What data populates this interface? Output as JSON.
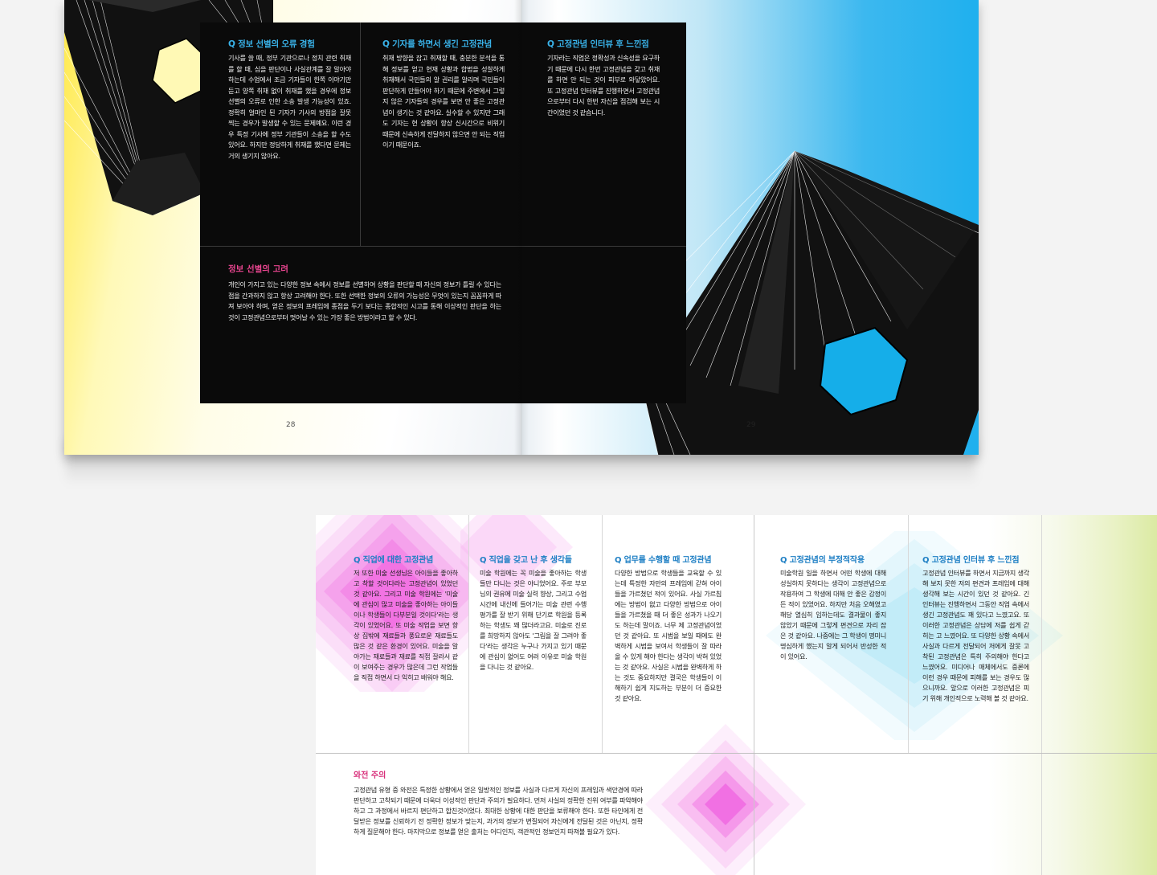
{
  "top_spread": {
    "left_page": {
      "columns": [
        {
          "heading": "Q 정보 선별의 오류 경험",
          "body": "기사를 쓸 때, 정부 기관으로나 정치 관련 취재를 할 때, 심을 판단이나 사실관계를 잘 알아야 하는데 수업에서 조금 기자들이 한쪽 이야기만 듣고 양쪽 취재 없이 취재를 했을 경우에 정보 선별의 오류로 인한 소송 발생 가능성이 있죠. 정확히 얼마인 된 기자가 기사의 방점을 잘못 찍는 경우가 발생할 수 있는 문제예요. 이런 경우 특정 기사에 정부 기관들이 소송을 할 수도 있어요. 하지만 정당하게 취재를 했다면 문제는 거의 생기지 않아요."
        },
        {
          "heading": "Q 기자를 하면서 생긴 고정관념",
          "body": "취재 방향을 잡고 취재할 때, 충분한 분석을 통해 정보를 얻고 현재 상황과 합법을 성찰하게 취재해서 국민들의 알 권리를 알리며 국민들이 판단하게 만들어야 하기 때문에 주변에서 그렇지 않은 기자들의 경우를 보면 안 좋은 고정관념이 생기는 것 같아요. 실수할 수 있지만 그래도 기자는 현 상황이 항상 신시간으로 비위기 때문에 신속하게 전달하지 않으면 안 되는 직업이기 때문이죠."
        }
      ],
      "bottom_heading": "정보 선별의 고려",
      "bottom_body": "개인이 가지고 있는 다양한 정보 속에서 정보를 선별하여 상황을 판단할 때 자신의 정보가 틀릴 수 있다는 점을 간과하지 않고 항상 고려해야 한다. 또한 선택한 정보의 오류의 가능성은 무엇이 있는지 꼼꼼하게 따져 보아야 하며, 얻은 정보의 프레임에 종점을 두기 보다는 종합적인 시고를 통해 이상적인 판단을 하는 것이 고정관념으로부터 멋어날 수 있는 가장 좋은 방법이라고 할 수 있다.",
      "page_number": "28"
    },
    "right_page": {
      "heading": "Q 고정관념 인터뷰 후 느낀점",
      "body": "기자라는 직업은 정확성과 신속성을 요구하기 때문에 다시 한번 고정관념을 갖고 취재를 하면 안 되는 것이 피부로 와닿았어요. 또 고정관념 인터뷰를 진행하면서 고정관념으로부터 다시 한번 자신을 점검해 보는 시간이었던 것 같습니다.",
      "page_number": "29"
    }
  },
  "bottom_spread": {
    "columns": [
      {
        "heading": "Q 직업에 대한 고정관념",
        "body": "저 또한 미술 선생님은 아이들을 좋아하고 착할 것이다라는 고정관념이 있었던 것 같아요. 그리고 미술 학원에는 '미술에 관심이 많고 미술을 좋아하는 아이들이나 학생들이 다부분일 것이다'라는 생각이 있었어요. 또 미술 작업을 보면 항상 집밖에 재료들과 풍요로운 재료들도 많은 것 같은 환경이 있어요. 미술을 알아가는 재료들과 재료를 직접 잘라서 같이 보여주는 경우가 많은데 그런 작업들을 직접 하면서 다 익히고 배워야 해요."
      },
      {
        "heading": "Q 직업을 갖고 난 후 생각들",
        "body": "미술 학원에는 꼭 미술을 좋아하는 학생들만 다니는 것은 아니었어요. 주로 부모님의 권유에 미술 실력 향상, 그리고 수업 시간에 내신에 들어가는 미술 관련 수행평가를 잘 받기 위해 단기로 학원을 등록하는 학생도 꽤 많더라고요. 미술로 진로를 희망하지 않아도 '그림을 잘 그려야 좋다'라는 생각은 누구나 가지고 있기 때문에 관심이 없어도 여러 이유로 미술 학원을 다니는 것 같아요."
      },
      {
        "heading": "Q 업무를 수행할 때 고정관념",
        "body": "다양한 방법으로 학생들을 교육할 수 있는데 특정한 자만의 프레임에 갇혀 아이들을 가르쳤던 적이 있어요. 사실 가르침에는 방법이 없고 다양한 방법으로 아이들을 가르쳤을 때 더 좋은 성과가 나오기도 하는데 말이죠. 너무 제 고정관념이었던 것 같아요. 또 시범을 보일 때에도 완벽하게 시범을 보여서 학생들이 잘 따라올 수 있게 해야 한다는 생각이 박혀 있었는 것 같아요. 사실은 시범을 완벽하게 하는 것도 중요하지만 결국은 학생들이 이해하기 쉽게 지도하는 부분이 더 중요한 것 같아요."
      },
      {
        "heading": "Q 고정관념의 부정적작용",
        "body": "미술학원 일을 하면서 어떤 학생에 대해 성실하지 못하다는 생각이 고정관념으로 작용하여 그 학생에 대해 안 좋은 감정이 든 적이 있었어요. 하지만 처음 오해였고 해당 열심히 임하는데도 결과물이 좋지 않았기 때문에 그렇게 편견으로 자리 잡은 것 같아요. 나중에는 그 학생이 명미니 명심하게 했는지 알게 되어서 반성한 적이 있어요."
      },
      {
        "heading": "Q 고정관념 인터뷰 후 느낀점",
        "body": "고정관념 인터뷰를 하면서 지금까지 생각해 보지 못한 저의 편견과 프레임에 대해 생각해 보는 시간이 있던 것 같아요. 긴 인터뷰는 진행하면서 그동안 직업 속에서 생긴 고정관념도 꽤 있다고 느꼈고요. 또 이러한 고정관념은 상담에 저를 쉽게 갇히는 고 느꼈어요. 또 다양한 상황 속에서 사실과 다르게 전달되어 저에게 잘못 고착된 고정관념은 특히 주의해야 한다고 느꼈어요. 미디어나 매체에서도 중론에 이런 경우 때문에 피해를 보는 경우도 많으니까요. 앞으로 이러한 고정관념은 피기 위해 개인적으로 노력해 볼 것 같아요."
      }
    ],
    "bottom_heading": "와전 주의",
    "bottom_body": "고정관념 유형 중 와전은 특정한 상황에서 얻은 일방적인 정보를 사실과 다르게 자신의 프레임과 색안경에 따라 판단하고 고착되기 때문에 더욱더 이성적인 판단과 주의가 필요하다. 먼저 사실의 정확한 진위 여부를 파악해야 하고 그 과정에서 바르지 편단하고 합친것이었다. 최대한 상황에 대한 판단을 보류해야 한다. 또한 타인에게 전달받은 정보를 신뢰하기 전 정확한 정보가 맞는지, 과거의 정보가 변질되어 자신에게 전달된 것은 아닌지, 정확하게 질문해야 한다. 마지막으로 정보를 얻은 출처는 어디인지, 객관적인 정보인지 따져볼 필요가 있다."
  },
  "colors": {
    "blue_accent": "#39b3ea",
    "pink_accent": "#e8458f",
    "dark_panel": "#0a0a0a",
    "yellow": "#ffe94a",
    "cyan": "#1fb0ee",
    "magenta": "#f060e0"
  }
}
